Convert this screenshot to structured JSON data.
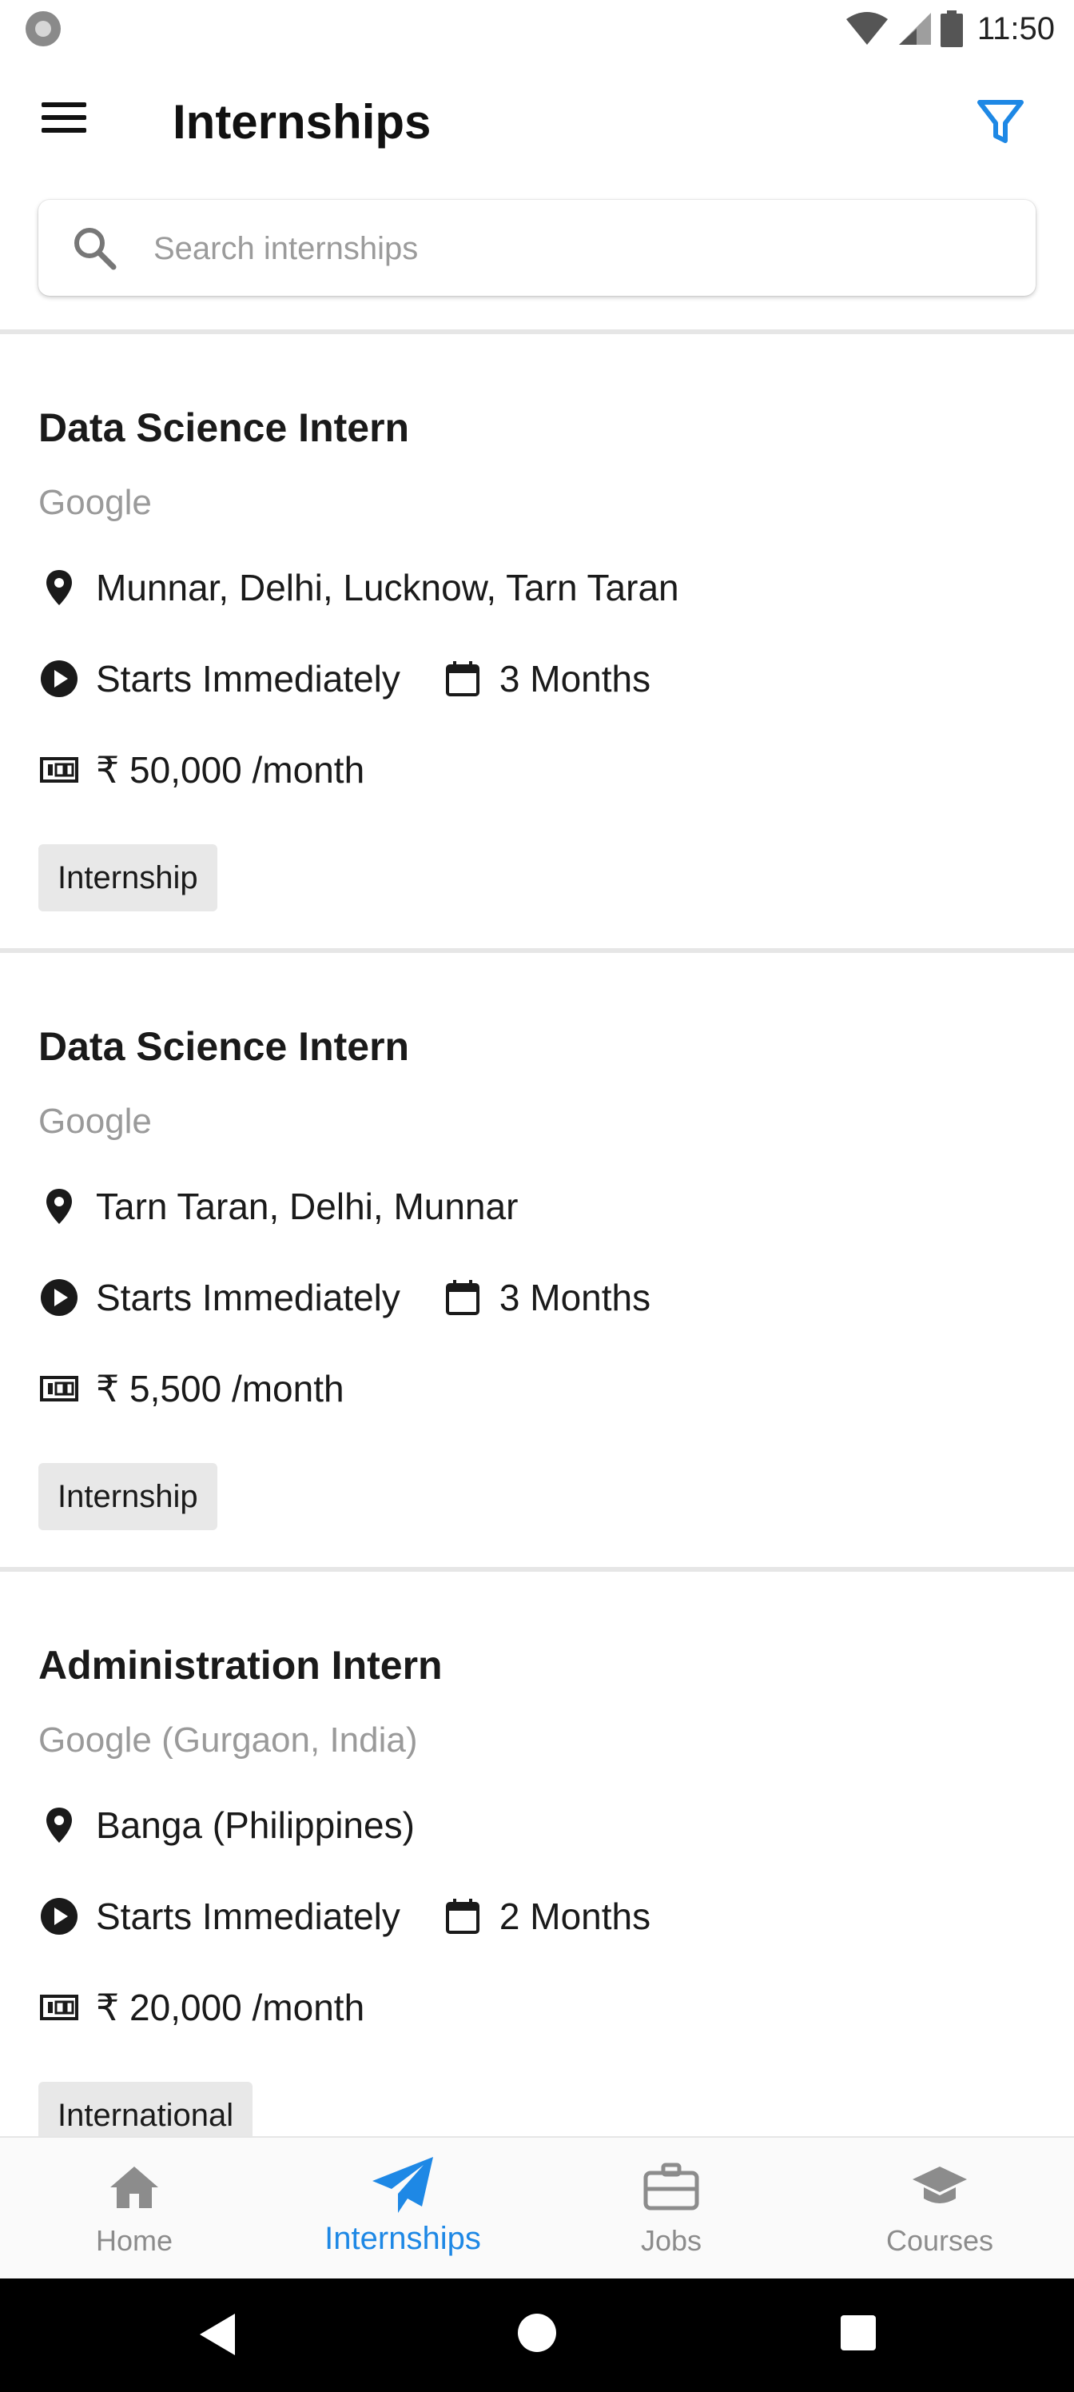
{
  "status_bar": {
    "time": "11:50",
    "icons": [
      "notification-dot-icon",
      "wifi-icon",
      "signal-icon",
      "battery-icon"
    ]
  },
  "app_bar": {
    "title": "Internships",
    "menu_icon": "hamburger-menu-icon",
    "filter_icon": "filter-icon"
  },
  "search": {
    "placeholder": "Search internships",
    "value": ""
  },
  "colors": {
    "accent": "#1e88e5",
    "muted_text": "#9a9a9a",
    "tag_bg": "#e8e8e8",
    "divider": "#e6e6e6"
  },
  "internships": [
    {
      "role": "Data Science Intern",
      "company": "Google",
      "locations": "Munnar, Delhi, Lucknow, Tarn Taran",
      "start": "Starts Immediately",
      "duration": "3 Months",
      "stipend": "₹ 50,000 /month",
      "tag": "Internship"
    },
    {
      "role": "Data Science Intern",
      "company": "Google",
      "locations": "Tarn Taran, Delhi, Munnar",
      "start": "Starts Immediately",
      "duration": "3 Months",
      "stipend": "₹ 5,500 /month",
      "tag": "Internship"
    },
    {
      "role": "Administration Intern",
      "company": "Google (Gurgaon, India)",
      "locations": "Banga (Philippines)",
      "start": "Starts Immediately",
      "duration": "2 Months",
      "stipend": "₹ 20,000 /month",
      "tag": "International"
    }
  ],
  "bottom_nav": {
    "active": "Internships",
    "items": [
      {
        "label": "Home",
        "icon": "home-icon"
      },
      {
        "label": "Internships",
        "icon": "paper-plane-icon"
      },
      {
        "label": "Jobs",
        "icon": "briefcase-icon"
      },
      {
        "label": "Courses",
        "icon": "graduation-cap-icon"
      }
    ]
  },
  "system_nav": {
    "buttons": [
      "back-icon",
      "home-circle-icon",
      "recents-square-icon"
    ]
  }
}
